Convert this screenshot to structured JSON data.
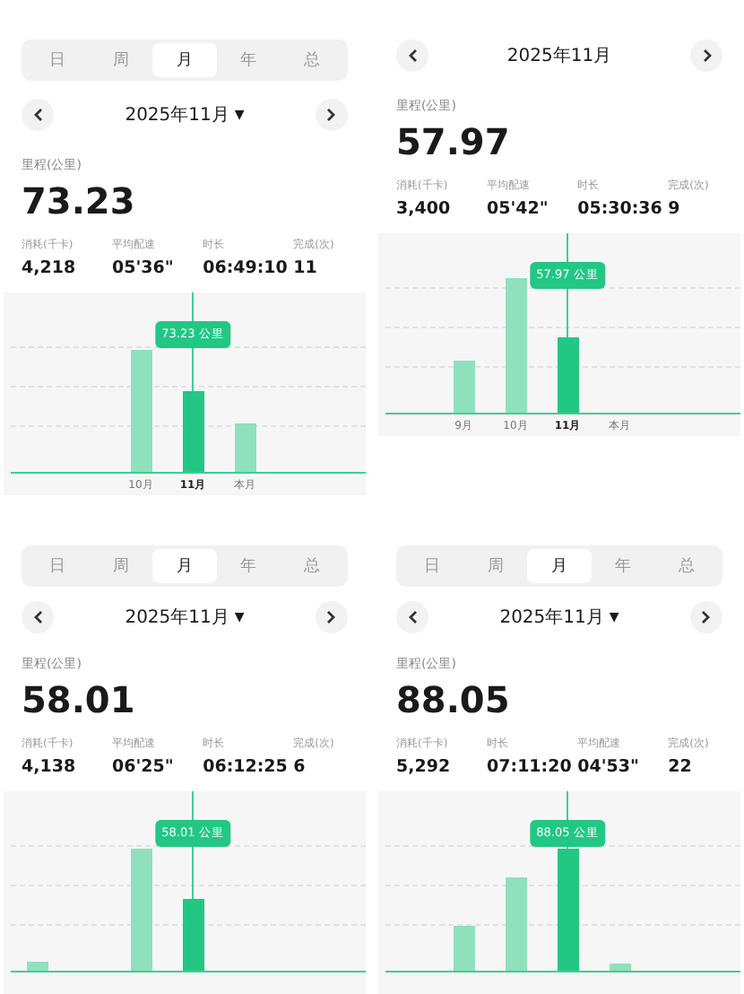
{
  "panels": [
    {
      "tabs": [
        {
          "label": "日",
          "selected": false
        },
        {
          "label": "周",
          "selected": false
        },
        {
          "label": "月",
          "selected": true
        },
        {
          "label": "年",
          "selected": false
        },
        {
          "label": "总",
          "selected": false
        }
      ],
      "date": "2025年11月",
      "caret": "▼",
      "distance_label": "里程(公里)",
      "distance": "73.23",
      "stats": [
        {
          "label": "消耗(千卡)",
          "value": "4,218"
        },
        {
          "label": "平均配速",
          "value": "05'36\""
        },
        {
          "label": "时长",
          "value": "06:49:10"
        },
        {
          "label": "完成(次)",
          "value": "11"
        }
      ],
      "tooltip": "73.23 公里",
      "axis_labels": [
        "10月",
        "11月",
        "本月"
      ]
    },
    {
      "date": "2025年11月",
      "distance_label": "里程(公里)",
      "distance": "57.97",
      "stats": [
        {
          "label": "消耗(千卡)",
          "value": "3,400"
        },
        {
          "label": "平均配速",
          "value": "05'42\""
        },
        {
          "label": "时长",
          "value": "05:30:36"
        },
        {
          "label": "完成(次)",
          "value": "9"
        }
      ],
      "tooltip": "57.97 公里",
      "axis_labels": [
        "9月",
        "10月",
        "11月",
        "本月"
      ]
    },
    {
      "tabs": [
        {
          "label": "日",
          "selected": false
        },
        {
          "label": "周",
          "selected": false
        },
        {
          "label": "月",
          "selected": true
        },
        {
          "label": "年",
          "selected": false
        },
        {
          "label": "总",
          "selected": false
        }
      ],
      "date": "2025年11月",
      "caret": "▼",
      "distance_label": "里程(公里)",
      "distance": "58.01",
      "stats": [
        {
          "label": "消耗(千卡)",
          "value": "4,138"
        },
        {
          "label": "平均配速",
          "value": "06'25\""
        },
        {
          "label": "时长",
          "value": "06:12:25"
        },
        {
          "label": "完成(次)",
          "value": "6"
        }
      ],
      "tooltip": "58.01 公里"
    },
    {
      "tabs": [
        {
          "label": "日",
          "selected": false
        },
        {
          "label": "周",
          "selected": false
        },
        {
          "label": "月",
          "selected": true
        },
        {
          "label": "年",
          "selected": false
        },
        {
          "label": "总",
          "selected": false
        }
      ],
      "date": "2025年11月",
      "caret": "▼",
      "distance_label": "里程(公里)",
      "distance": "88.05",
      "stats": [
        {
          "label": "消耗(千卡)",
          "value": "5,292"
        },
        {
          "label": "时长",
          "value": "07:11:20"
        },
        {
          "label": "平均配速",
          "value": "04'53\""
        },
        {
          "label": "完成(次)",
          "value": "22"
        }
      ],
      "tooltip": "88.05 公里"
    }
  ]
}
